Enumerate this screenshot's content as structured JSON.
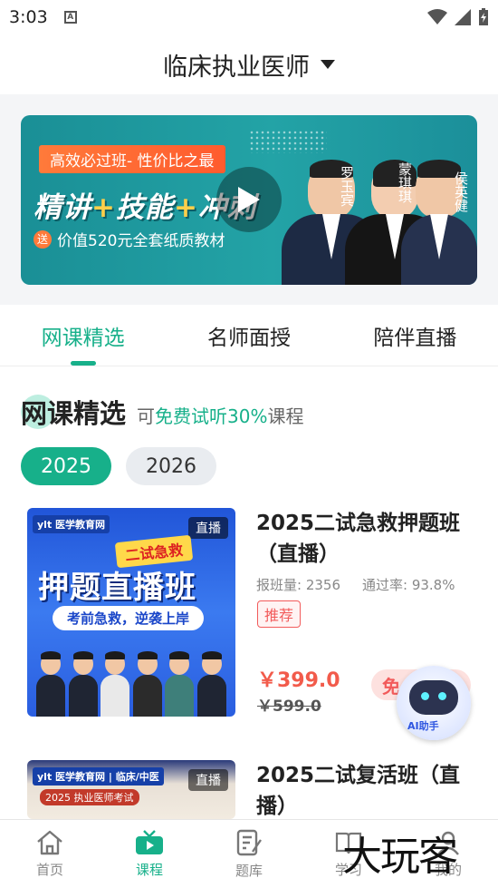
{
  "status_bar": {
    "time": "3:03",
    "sim_letter": "A"
  },
  "header": {
    "title": "临床执业医师"
  },
  "banner": {
    "tag": "高效必过班- 性价比之最",
    "headline_parts": [
      "精讲",
      "+",
      "技能",
      "+",
      "冲刺"
    ],
    "gift_icon_text": "送",
    "gift_text": "价值520元全套纸质教材",
    "teachers": [
      "罗玉宾",
      "蒙琪琪",
      "侯英健"
    ]
  },
  "tabs": [
    {
      "label": "网课精选",
      "active": true
    },
    {
      "label": "名师面授",
      "active": false
    },
    {
      "label": "陪伴直播",
      "active": false
    }
  ],
  "section": {
    "title": "网课精选",
    "sub_prefix": "可",
    "sub_highlight": "免费试听30%",
    "sub_suffix": "课程"
  },
  "years": [
    {
      "label": "2025",
      "active": true
    },
    {
      "label": "2026",
      "active": false
    }
  ],
  "courses": [
    {
      "title": "2025二试急救押题班（直播）",
      "enroll": "报班量: 2356",
      "pass_rate": "通过率: 93.8%",
      "tag": "推荐",
      "price": "￥399.0",
      "old_price": "￥599.0",
      "free_btn": "免",
      "thumb_logo": "ylt 医学教育网",
      "thumb_live": "直播",
      "thumb_ribbon": "二试急救",
      "thumb_main": "押题直播班",
      "thumb_pill": "考前急救，逆袭上岸"
    },
    {
      "title": "2025二试复活班（直播）",
      "thumb_logo": "ylt 医学教育网 | 临床/中医",
      "thumb_live": "直播",
      "thumb_line": "2025 执业医师考试"
    }
  ],
  "assistant": {
    "label": "AI助手"
  },
  "bottom_nav": [
    {
      "label": "首页",
      "icon": "home-icon",
      "active": false
    },
    {
      "label": "课程",
      "icon": "tv-icon",
      "active": true
    },
    {
      "label": "题库",
      "icon": "notes-icon",
      "active": false
    },
    {
      "label": "学习",
      "icon": "book-icon",
      "active": false
    },
    {
      "label": "我的",
      "icon": "person-icon",
      "active": false
    }
  ],
  "watermark": "大玩客",
  "colors": {
    "accent": "#17b08a",
    "price": "#f25b4b",
    "banner": "#1a8f96"
  }
}
